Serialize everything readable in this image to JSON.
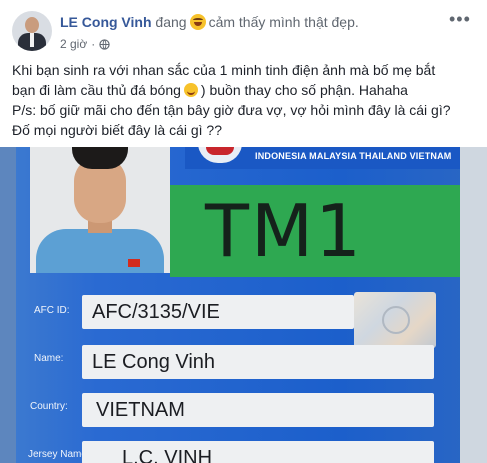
{
  "post": {
    "author": "LE Cong Vinh",
    "feeling_prefix": "đang",
    "feeling_text": "cảm thấy mình thật đẹp.",
    "time": "2 giờ",
    "more_label": "•••",
    "text_lines": [
      "Khi bạn sinh ra với nhan sắc của 1 minh tinh điện ảnh mà bố mẹ bắt",
      "bạn đi làm cầu thủ đá bóng",
      ") buồn thay cho số phận. Hahaha",
      "P/s: bố giữ mãi cho đến tận bây giờ đưa vợ, vợ hỏi mình đây là cái gì?",
      "Đố mọi người biết đây là cái gì ??"
    ]
  },
  "photo": {
    "countries": "INDONESIA MALAYSIA THAILAND VIETNAM",
    "code": "TM1",
    "fields": [
      {
        "label": "AFC ID:",
        "value": "AFC/3135/VIE"
      },
      {
        "label": "Name:",
        "value": "LE Cong Vinh"
      },
      {
        "label": "Country:",
        "value": "VIETNAM"
      },
      {
        "label": "Jersey Name:",
        "value": "L.C. VINH"
      }
    ]
  },
  "colors": {
    "author_link": "#365899",
    "card_blue": "#1c5fcb",
    "card_green": "#2ea851"
  },
  "icons": [
    "laughing-emoji-icon",
    "globe-icon",
    "more-options-icon",
    "smiling-emoji-icon"
  ]
}
